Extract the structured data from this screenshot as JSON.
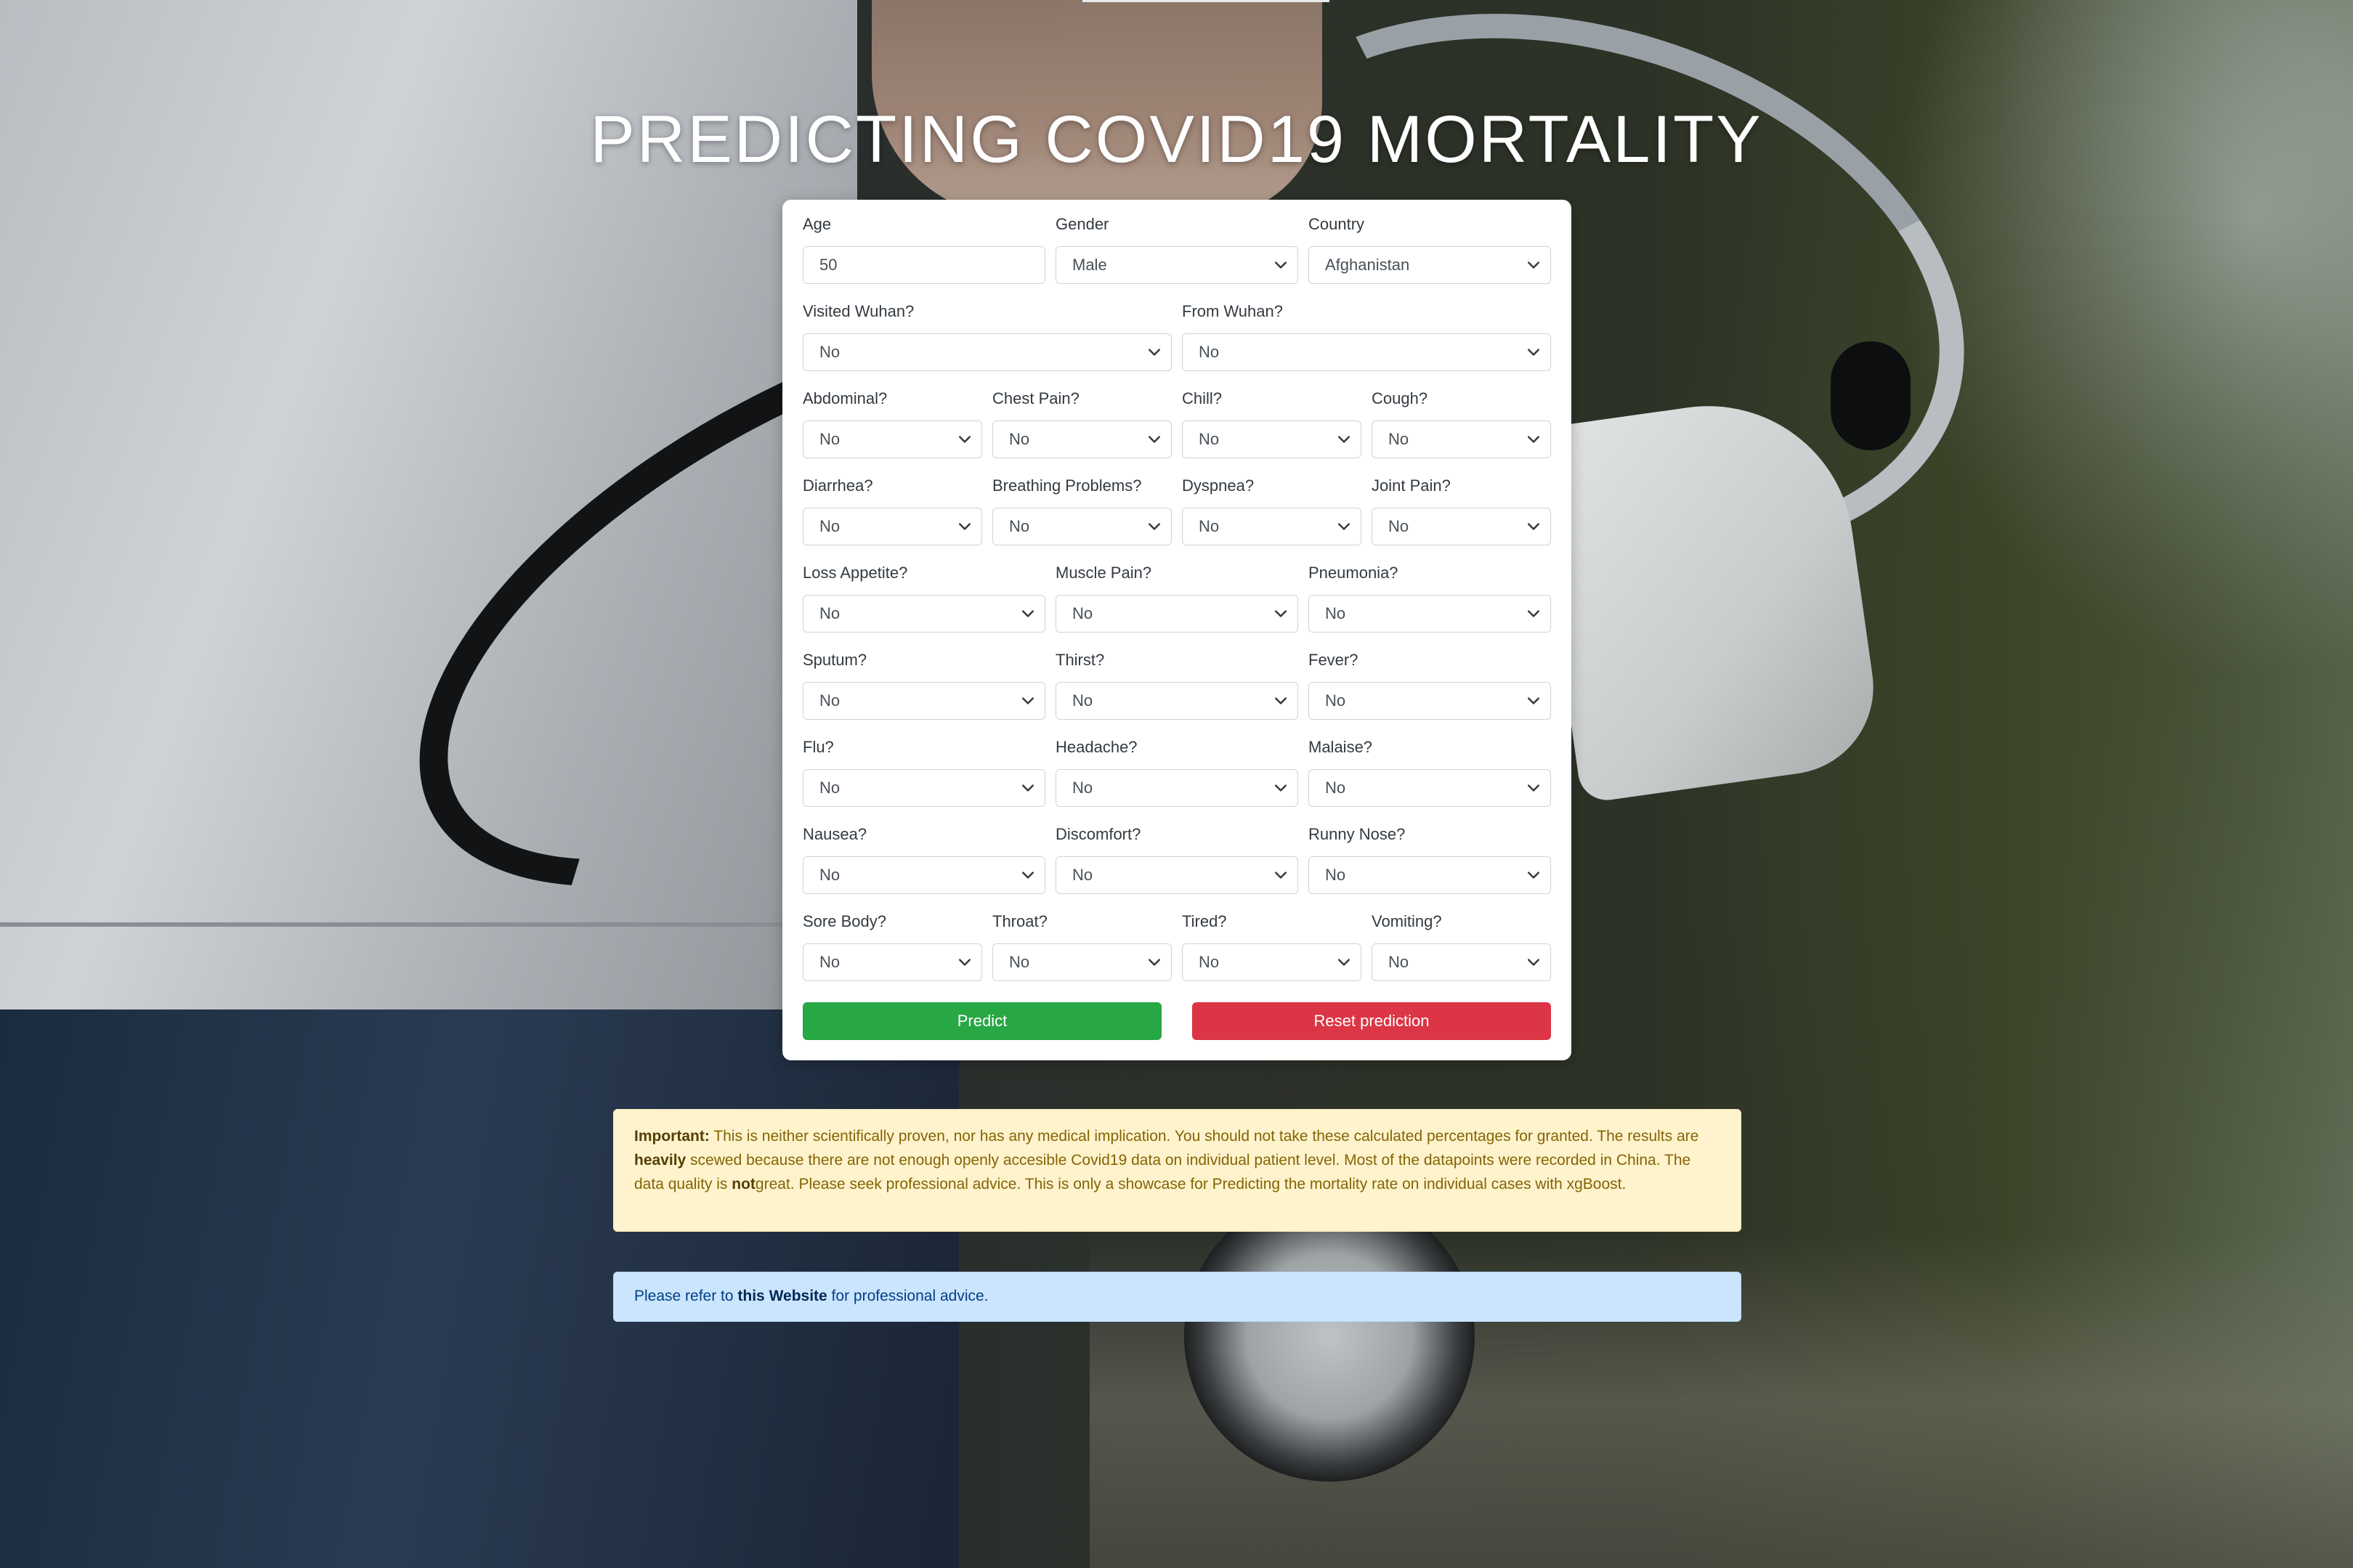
{
  "title": "PREDICTING COVID19 MORTALITY",
  "icons": {
    "select_chevron": "chevron-down-icon"
  },
  "colors": {
    "predict": "#28a745",
    "reset": "#dc3545",
    "warning_bg": "#fff3cd",
    "info_bg": "#cce5ff"
  },
  "form": {
    "age": {
      "label": "Age",
      "value": "50"
    },
    "gender": {
      "label": "Gender",
      "value": "Male"
    },
    "country": {
      "label": "Country",
      "value": "Afghanistan"
    },
    "visited_wuhan": {
      "label": "Visited Wuhan?",
      "value": "No"
    },
    "from_wuhan": {
      "label": "From Wuhan?",
      "value": "No"
    },
    "abdominal": {
      "label": "Abdominal?",
      "value": "No"
    },
    "chest_pain": {
      "label": "Chest Pain?",
      "value": "No"
    },
    "chill": {
      "label": "Chill?",
      "value": "No"
    },
    "cough": {
      "label": "Cough?",
      "value": "No"
    },
    "diarrhea": {
      "label": "Diarrhea?",
      "value": "No"
    },
    "breathing_problems": {
      "label": "Breathing Problems?",
      "value": "No"
    },
    "dyspnea": {
      "label": "Dyspnea?",
      "value": "No"
    },
    "joint_pain": {
      "label": "Joint Pain?",
      "value": "No"
    },
    "loss_appetite": {
      "label": "Loss Appetite?",
      "value": "No"
    },
    "muscle_pain": {
      "label": "Muscle Pain?",
      "value": "No"
    },
    "pneumonia": {
      "label": "Pneumonia?",
      "value": "No"
    },
    "sputum": {
      "label": "Sputum?",
      "value": "No"
    },
    "thirst": {
      "label": "Thirst?",
      "value": "No"
    },
    "fever": {
      "label": "Fever?",
      "value": "No"
    },
    "flu": {
      "label": "Flu?",
      "value": "No"
    },
    "headache": {
      "label": "Headache?",
      "value": "No"
    },
    "malaise": {
      "label": "Malaise?",
      "value": "No"
    },
    "nausea": {
      "label": "Nausea?",
      "value": "No"
    },
    "discomfort": {
      "label": "Discomfort?",
      "value": "No"
    },
    "runny_nose": {
      "label": "Runny Nose?",
      "value": "No"
    },
    "sore_body": {
      "label": "Sore Body?",
      "value": "No"
    },
    "throat": {
      "label": "Throat?",
      "value": "No"
    },
    "tired": {
      "label": "Tired?",
      "value": "No"
    },
    "vomiting": {
      "label": "Vomiting?",
      "value": "No"
    },
    "predict_label": "Predict",
    "reset_label": "Reset prediction"
  },
  "warning": {
    "strong": "Important:",
    "part1": " This is neither scientifically proven, nor has any medical implication. You should not take these calculated percentages for granted. The results are ",
    "heavily": "heavily",
    "part2": " scewed because there are not enough openly accesible Covid19 data on individual patient level. Most of the datapoints were recorded in China. The data quality is ",
    "not": "not",
    "part3": "great. Please seek professional advice. This is only a showcase for Predicting the mortality rate on individual cases with xgBoost."
  },
  "info": {
    "before": "Please refer to ",
    "link": "this Website",
    "after": " for professional advice."
  }
}
